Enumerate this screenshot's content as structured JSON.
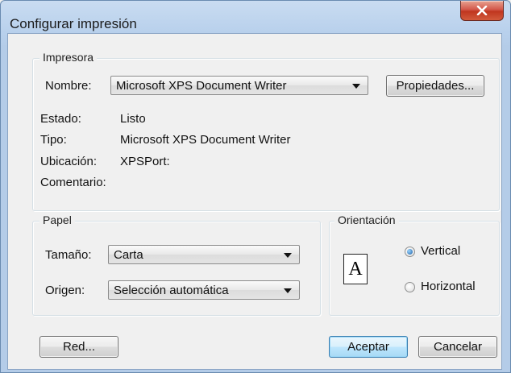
{
  "window": {
    "title": "Configurar impresión"
  },
  "printer": {
    "group_label": "Impresora",
    "name_label": "Nombre:",
    "name_value": "Microsoft XPS Document Writer",
    "properties_button": "Propiedades...",
    "status_label": "Estado:",
    "status_value": "Listo",
    "type_label": "Tipo:",
    "type_value": "Microsoft XPS Document Writer",
    "location_label": "Ubicación:",
    "location_value": "XPSPort:",
    "comment_label": "Comentario:",
    "comment_value": ""
  },
  "paper": {
    "group_label": "Papel",
    "size_label": "Tamaño:",
    "size_value": "Carta",
    "source_label": "Origen:",
    "source_value": "Selección automática"
  },
  "orientation": {
    "group_label": "Orientación",
    "icon_letter": "A",
    "options": [
      {
        "label": "Vertical",
        "checked": true
      },
      {
        "label": "Horizontal",
        "checked": false
      }
    ]
  },
  "buttons": {
    "network": "Red...",
    "ok": "Aceptar",
    "cancel": "Cancelar"
  },
  "colors": {
    "title_bar": "#b8d0ec",
    "close_button": "#c7432c",
    "default_button_border": "#3c7fb1",
    "dialog_background": "#f0f0f0"
  }
}
